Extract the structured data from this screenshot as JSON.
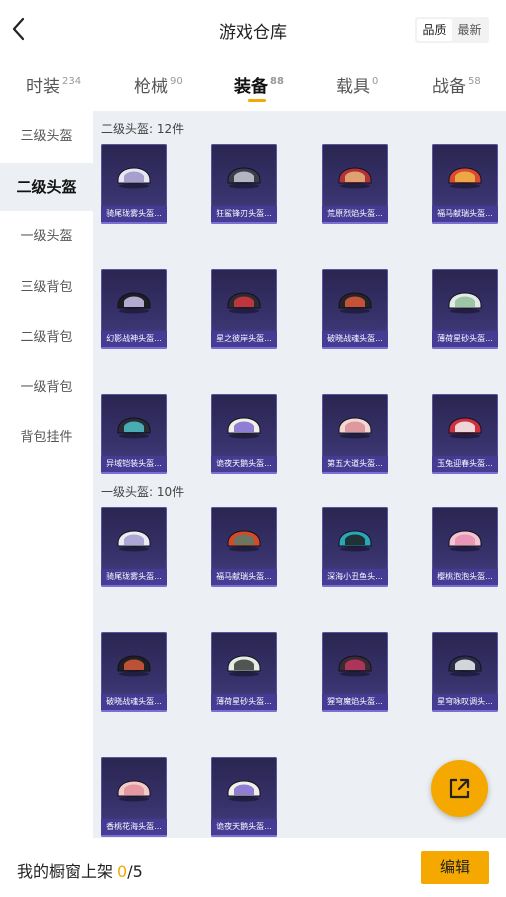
{
  "header": {
    "title": "游戏仓库",
    "sort_options": [
      {
        "label": "品质",
        "active": true
      },
      {
        "label": "最新",
        "active": false
      }
    ]
  },
  "tabs": [
    {
      "label": "时装",
      "count": "234",
      "active": false
    },
    {
      "label": "枪械",
      "count": "90",
      "active": false
    },
    {
      "label": "装备",
      "count": "88",
      "active": true
    },
    {
      "label": "载具",
      "count": "0",
      "active": false
    },
    {
      "label": "战备",
      "count": "58",
      "active": false
    }
  ],
  "sidebar": {
    "items": [
      {
        "label": "三级头盔",
        "active": false
      },
      {
        "label": "二级头盔",
        "active": true
      },
      {
        "label": "一级头盔",
        "active": false
      },
      {
        "label": "三级背包",
        "active": false
      },
      {
        "label": "二级背包",
        "active": false
      },
      {
        "label": "一级背包",
        "active": false
      },
      {
        "label": "背包挂件",
        "active": false
      }
    ]
  },
  "sections": [
    {
      "title": "二级头盔: 12件",
      "items": [
        {
          "name": "骑尾珑雾头盔...",
          "color": "#e8e6f0",
          "accent": "#9b92c8"
        },
        {
          "name": "狂鲨锋刃头盔...",
          "color": "#3b3d4a",
          "accent": "#c9cbd6"
        },
        {
          "name": "荒原烈焰头盔...",
          "color": "#b2323a",
          "accent": "#e9b47a"
        },
        {
          "name": "福马献瑞头盔...",
          "color": "#d94a2e",
          "accent": "#f0b84a"
        },
        {
          "name": "幻影战神头盔...",
          "color": "#1d1d24",
          "accent": "#cfc6ee"
        },
        {
          "name": "星之彼岸头盔...",
          "color": "#2a2a33",
          "accent": "#d7373f"
        },
        {
          "name": "破晓战魂头盔...",
          "color": "#232329",
          "accent": "#e05a3a"
        },
        {
          "name": "薄荷星砂头盔...",
          "color": "#e3ece4",
          "accent": "#8fc09a"
        },
        {
          "name": "异域铠装头盔...",
          "color": "#2b2b36",
          "accent": "#4fc3c8"
        },
        {
          "name": "诡夜天鹅头盔...",
          "color": "#f1efe7",
          "accent": "#7e6ad0"
        },
        {
          "name": "第五大道头盔...",
          "color": "#f4d6d4",
          "accent": "#d98e95"
        },
        {
          "name": "玉兔迎春头盔...",
          "color": "#cf3040",
          "accent": "#f3f3f3"
        }
      ]
    },
    {
      "title": "一级头盔: 10件",
      "items": [
        {
          "name": "骑尾珑雾头盔...",
          "color": "#ecebf3",
          "accent": "#a29bd0"
        },
        {
          "name": "福马献瑞头盔...",
          "color": "#d64a28",
          "accent": "#5a7d6a"
        },
        {
          "name": "深海小丑鱼头...",
          "color": "#2aa6b8",
          "accent": "#1d1d1d"
        },
        {
          "name": "樱桃泡泡头盔...",
          "color": "#f2c4d4",
          "accent": "#e98fb0"
        },
        {
          "name": "破晓战魂头盔...",
          "color": "#1f1f25",
          "accent": "#d95a3a"
        },
        {
          "name": "薄荷星砂头盔...",
          "color": "#e4ede5",
          "accent": "#3a3a3a"
        },
        {
          "name": "猩穹魔焰头盔...",
          "color": "#3a2a33",
          "accent": "#c23760"
        },
        {
          "name": "星穹咏叹调头...",
          "color": "#2b2e4a",
          "accent": "#f2f2f2"
        },
        {
          "name": "香桃花海头盔...",
          "color": "#f3c9c9",
          "accent": "#e08f9a"
        },
        {
          "name": "诡夜天鹅头盔...",
          "color": "#f1efe7",
          "accent": "#7e6ad0"
        }
      ]
    }
  ],
  "bottom": {
    "showcase_label": "我的橱窗上架",
    "current": "0",
    "separator": "/",
    "max": "5",
    "edit_label": "编辑"
  },
  "icons": {
    "back": "chevron-left-icon",
    "fab": "share-external-icon"
  }
}
